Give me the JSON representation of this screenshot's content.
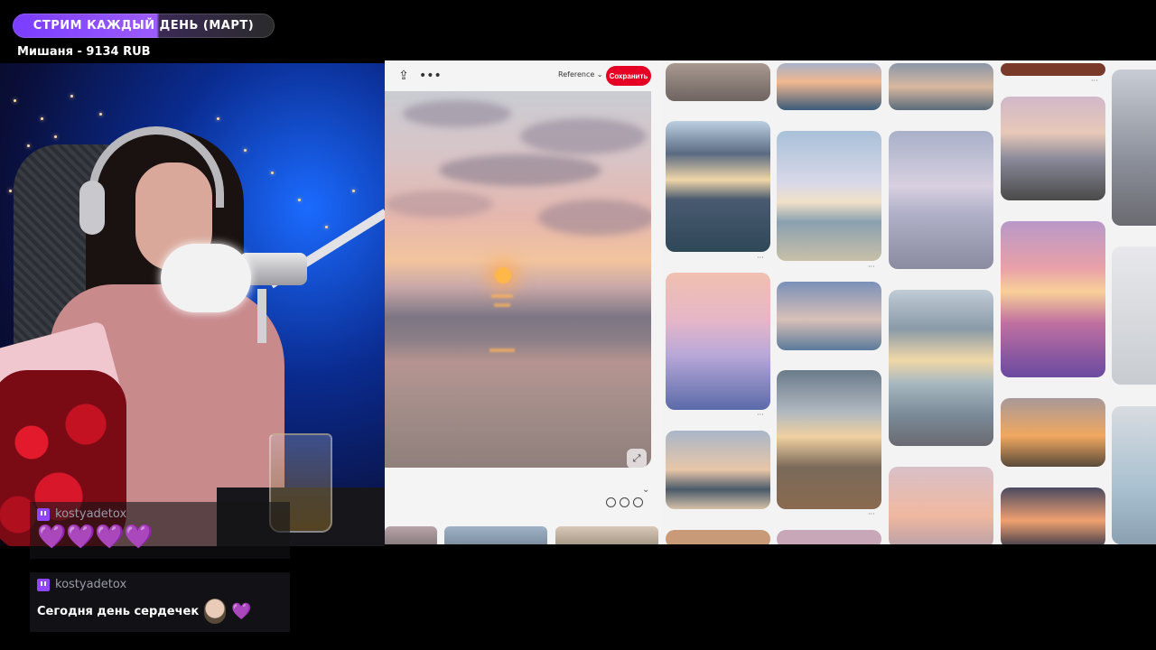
{
  "stream": {
    "goal_text": "СТРИМ КАЖДЫЙ ДЕНЬ (МАРТ)",
    "goal_progress_percent": 60,
    "donor_line": "Мишаня - 9134 RUB"
  },
  "chat": {
    "messages": [
      {
        "user": "kostyadetox",
        "hearts": [
          "💜",
          "💜",
          "💜",
          "💜"
        ]
      },
      {
        "user": "kostyadetox",
        "text": "Сегодня день сердечек",
        "emote_heart": "💜"
      }
    ]
  },
  "pin": {
    "reference_label": "Reference",
    "save_label": "Сохранить",
    "icons": [
      "share-icon",
      "more-icon",
      "expand-icon",
      "lens-icon",
      "chevron-down-icon",
      "emoji-icon",
      "sticker-icon",
      "image-icon"
    ]
  },
  "colors": {
    "save_button": "#e60023",
    "goal_fill": "#9c5cff",
    "twitch": "#9147ff"
  }
}
